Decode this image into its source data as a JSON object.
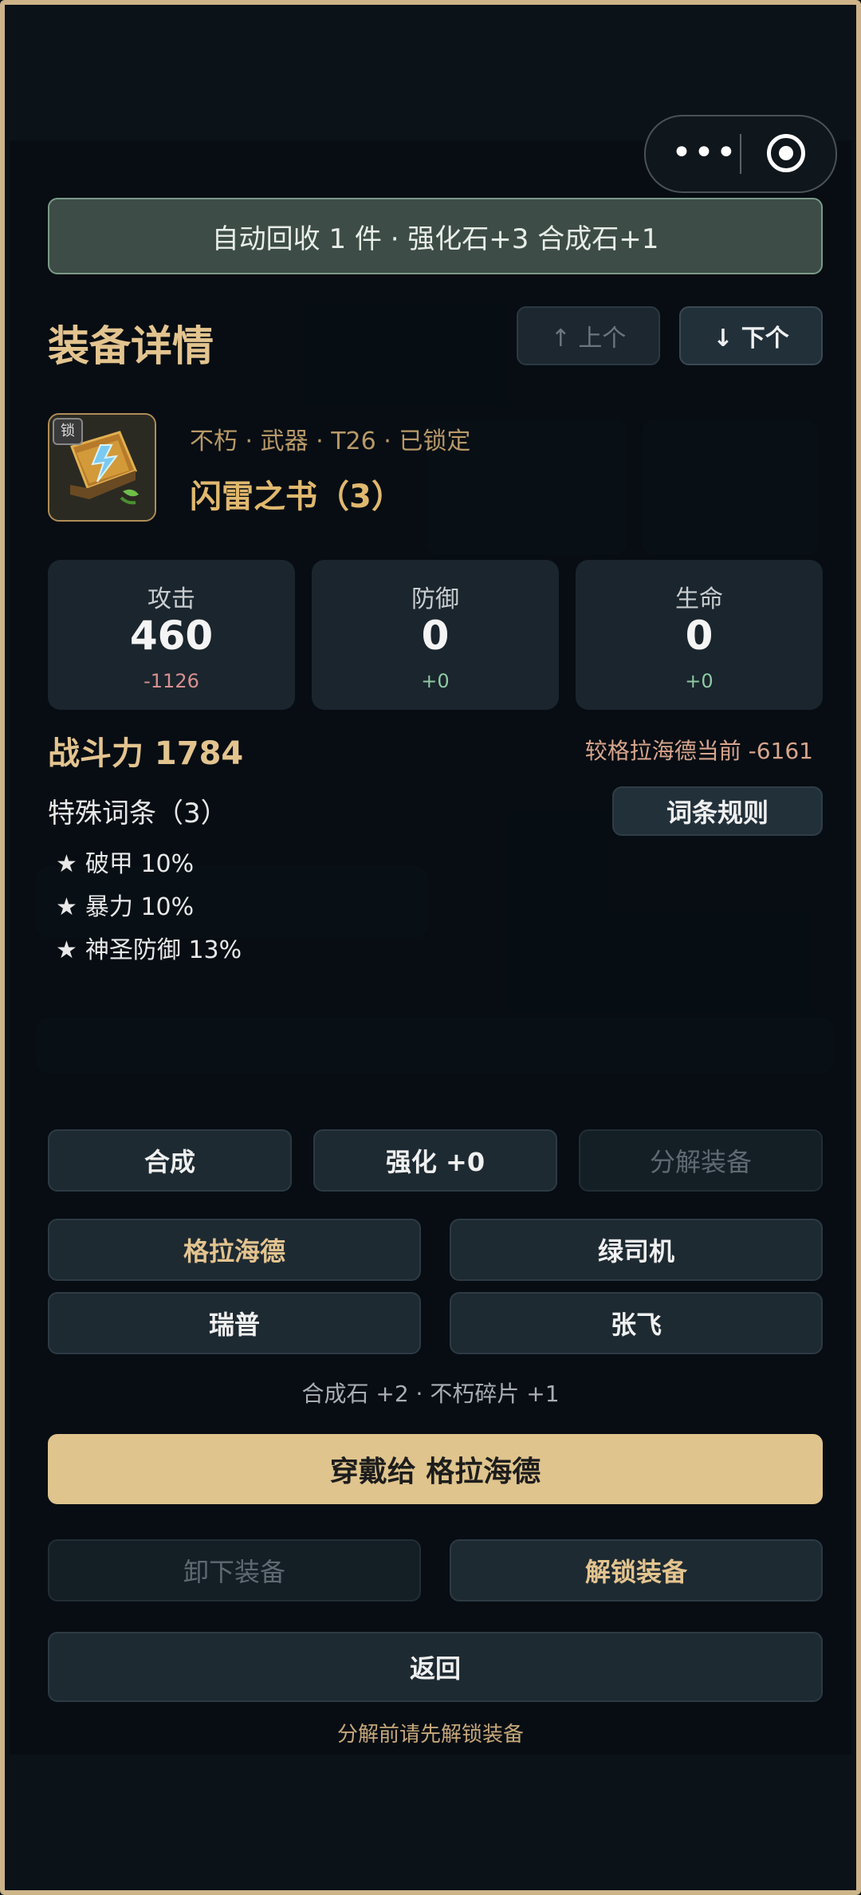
{
  "capsule": {
    "more_icon": "more-dots-icon",
    "close_icon": "target-icon"
  },
  "toast": {
    "text": "自动回收 1 件 · 强化石+3 合成石+1"
  },
  "header": {
    "title": "装备详情",
    "prev_label": "↑ 上个",
    "next_label": "↓ 下个"
  },
  "item": {
    "lock_badge": "锁",
    "meta": "不朽 · 武器 · T26 · 已锁定",
    "name": "闪雷之书（3）",
    "icon": "lightning-book-icon"
  },
  "stats": [
    {
      "label": "攻击",
      "value": "460",
      "delta": "-1126",
      "delta_color": "#d68f8f"
    },
    {
      "label": "防御",
      "value": "0",
      "delta": "+0",
      "delta_color": "#8fc9a3"
    },
    {
      "label": "生命",
      "value": "0",
      "delta": "+0",
      "delta_color": "#8fc9a3"
    }
  ],
  "power": {
    "label": "战斗力 1784",
    "compare": "较格拉海德当前 -6161"
  },
  "traits": {
    "title": "特殊词条（3）",
    "rules_label": "词条规则",
    "items": [
      "破甲 10%",
      "暴力 10%",
      "神圣防御 13%"
    ]
  },
  "actions": {
    "compose": "合成",
    "enhance": "强化 +0",
    "dismantle": "分解装备"
  },
  "characters": [
    "格拉海德",
    "绿司机",
    "瑞普",
    "张飞"
  ],
  "reward_text": "合成石 +2 · 不朽碎片 +1",
  "equip_label": "穿戴给 格拉海德",
  "unequip_label": "卸下装备",
  "unlock_label": "解锁装备",
  "back_label": "返回",
  "note": "分解前请先解锁装备",
  "colors": {
    "accent_gold": "#e3c48f",
    "toast_bg": "#3d4c46",
    "panel_bg": "#1a252d"
  }
}
